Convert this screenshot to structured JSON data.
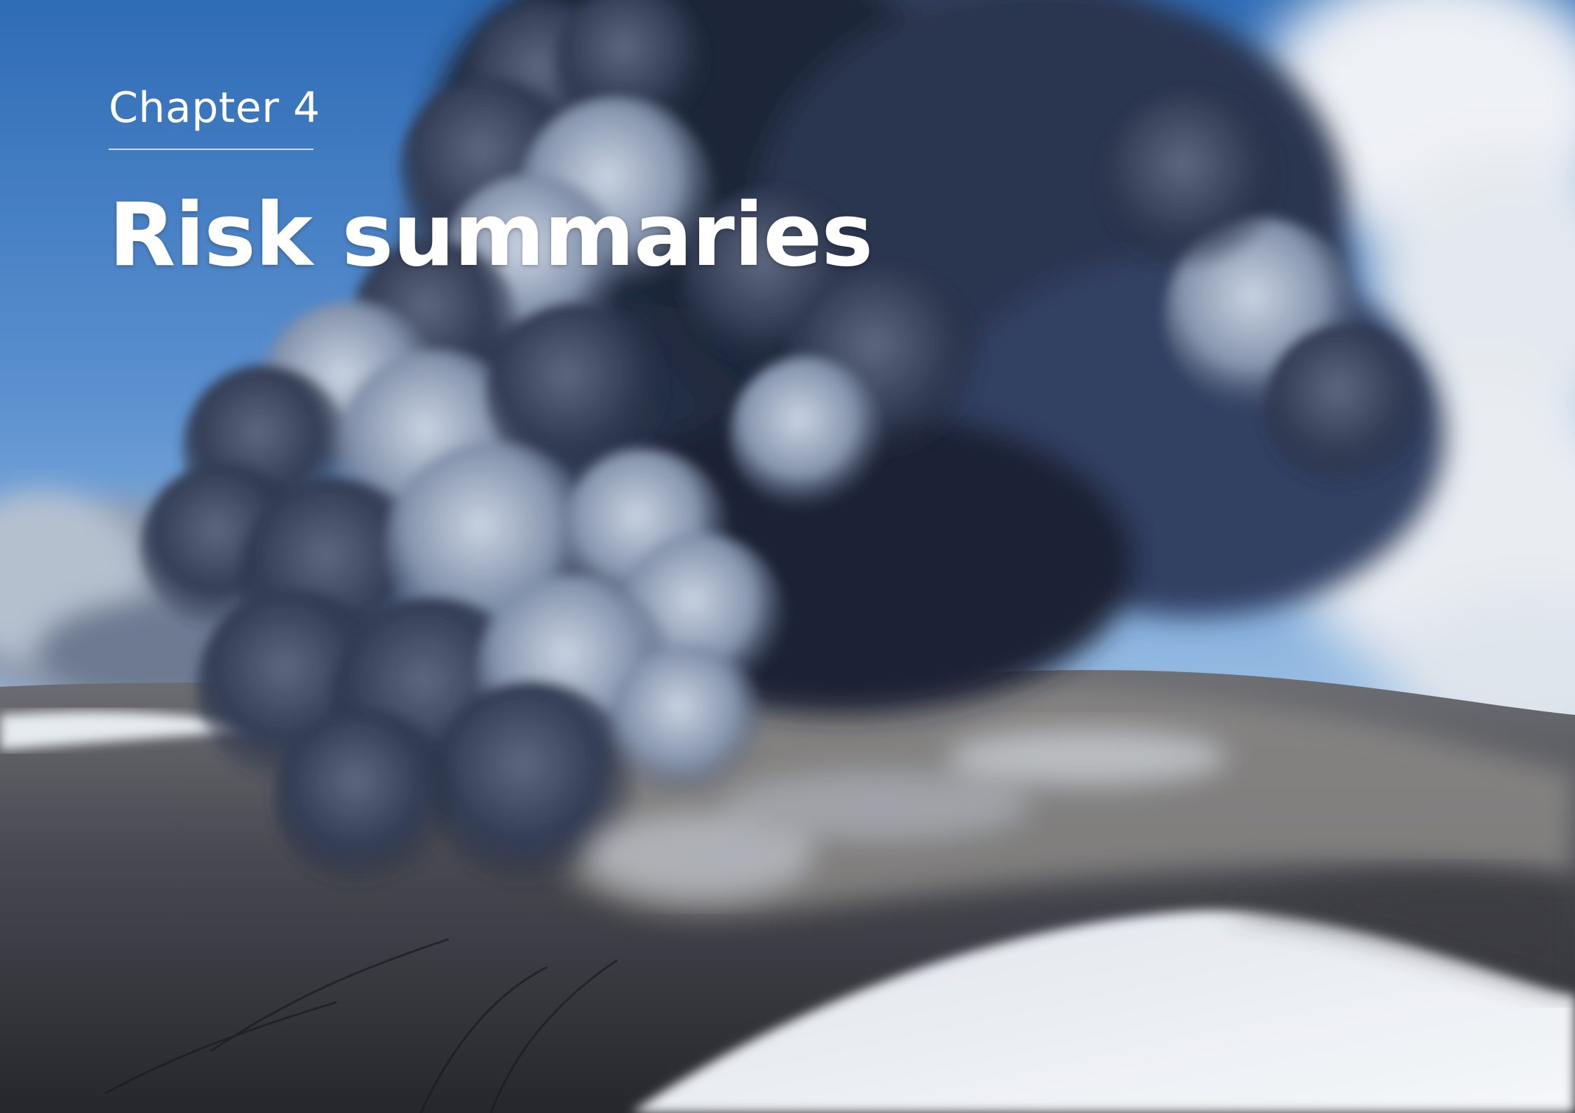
{
  "chapter": {
    "label": "Chapter 4",
    "title": "Risk summaries"
  },
  "photo": {
    "subject": "volcanic-ash-plume",
    "colors": {
      "sky": "#3f79c2",
      "sky_light": "#a9c9e8",
      "plume_dark": "#1f2738",
      "plume_mid": "#4a5670",
      "plume_light": "#aab7cc",
      "ground_dark": "#2b2c33",
      "ground_ash": "#7a7876",
      "snow": "#e8ecf1"
    }
  }
}
